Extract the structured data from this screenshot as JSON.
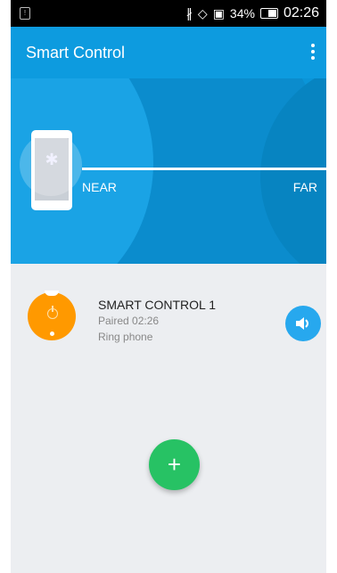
{
  "status_bar": {
    "battery": "34%",
    "time": "02:26",
    "icons": [
      "notification-icon",
      "bluetooth-icon",
      "rotation-icon",
      "sim-icon",
      "battery-icon"
    ]
  },
  "app_bar": {
    "title": "Smart Control",
    "menu_icon": "more-vert-icon"
  },
  "range": {
    "near_label": "NEAR",
    "far_label": "FAR"
  },
  "device": {
    "name": "SMART CONTROL 1",
    "paired": "Paired 02:26",
    "action": "Ring phone"
  },
  "fab": {
    "label": "+"
  },
  "colors": {
    "accent": "#0d9bdf",
    "tag": "#ff9900",
    "fab": "#27c264",
    "speaker": "#27a8ee"
  }
}
